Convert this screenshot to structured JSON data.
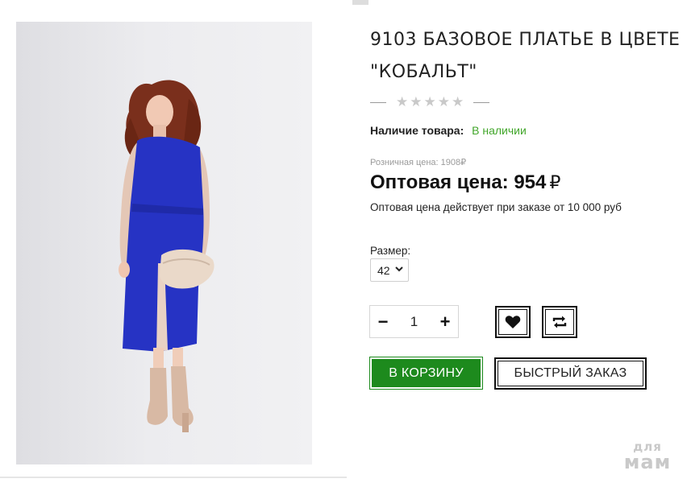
{
  "product": {
    "title": "9103 БАЗОВОЕ ПЛАТЬЕ В ЦВЕТЕ \"КОБАЛЬТ\"",
    "rating": {
      "stars": [
        "★",
        "★",
        "★",
        "★",
        "★"
      ],
      "value": 0,
      "max": 5
    },
    "availability": {
      "label": "Наличие товара:",
      "value": "В наличии"
    },
    "retail_price": "Розничная цена: 1908₽",
    "wholesale_price": {
      "label": "Оптовая цена: 954",
      "currency": "₽"
    },
    "wholesale_note": "Оптовая цена действует при заказе от 10 000 руб",
    "size": {
      "label": "Размер:",
      "selected": "42"
    },
    "quantity": {
      "minus": "−",
      "value": "1",
      "plus": "+"
    },
    "cart_button": "В КОРЗИНУ",
    "quick_order_button": "БЫСТРЫЙ ЗАКАЗ"
  },
  "watermark": {
    "line1": "для",
    "line2": "мам"
  },
  "icons": [
    "heart-icon",
    "compare-icon",
    "chevron-down-icon"
  ],
  "colors": {
    "accent_green": "#1d8a1d",
    "in_stock_green": "#41a62a",
    "dress_cobalt": "#2633c4"
  }
}
